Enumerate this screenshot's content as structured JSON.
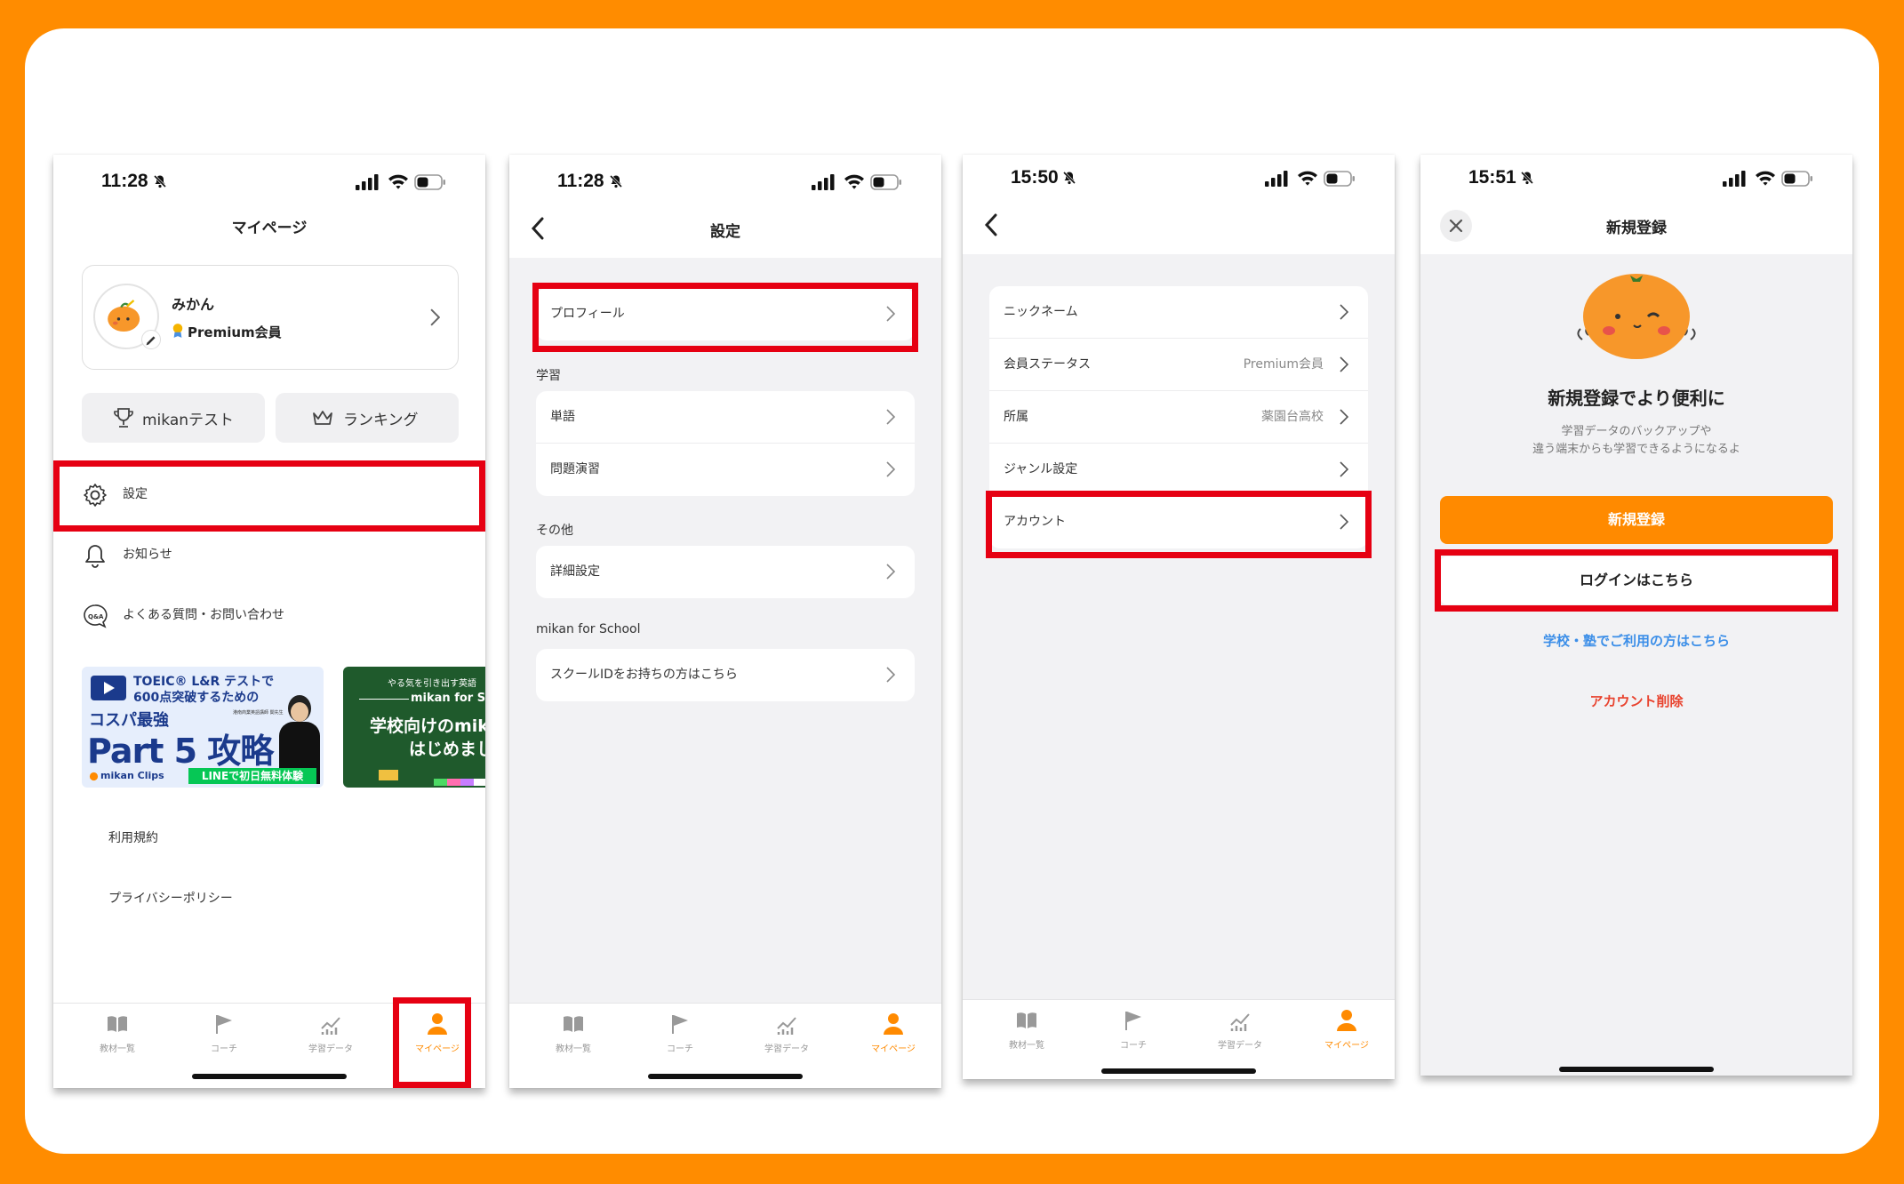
{
  "status_bar": {
    "phone1_time": "11:28",
    "phone2_time": "11:28",
    "phone3_time": "15:50",
    "phone4_time": "15:51"
  },
  "tabs": [
    "教材一覧",
    "コーチ",
    "学習データ",
    "マイページ"
  ],
  "mypage": {
    "title": "マイページ",
    "profile_name": "みかん",
    "profile_status": "Premium会員",
    "test_button": "mikanテスト",
    "ranking_button": "ランキング",
    "menu_settings": "設定",
    "menu_news": "お知らせ",
    "menu_faq": "よくある質問・お問い合わせ",
    "banner1": {
      "line1": "TOEIC® L&R テストで",
      "line2": "600点突破するための",
      "line3": "コスパ最強",
      "big": "Part 5 攻略",
      "caption": "港南商業英語講師 関先生",
      "brand": "mikan Clips",
      "cta": "LINEで初日無料体験"
    },
    "banner2": {
      "line1": "やる気を引き出す英語",
      "line2": "mikan for Sc",
      "line3": "学校向けのmik",
      "line4": "はじめまし"
    },
    "link_terms": "利用規約",
    "link_privacy": "プライバシーポリシー"
  },
  "settings": {
    "title": "設定",
    "profile_row": "プロフィール",
    "section_study": "学習",
    "row_words": "単語",
    "row_drills": "問題演習",
    "section_other": "その他",
    "row_detail": "詳細設定",
    "section_school": "mikan for School",
    "row_school_id": "スクールIDをお持ちの方はこちら"
  },
  "profile": {
    "rows": [
      {
        "label": "ニックネーム",
        "value": ""
      },
      {
        "label": "会員ステータス",
        "value": "Premium会員"
      },
      {
        "label": "所属",
        "value": "薬園台高校"
      },
      {
        "label": "ジャンル設定",
        "value": ""
      },
      {
        "label": "アカウント",
        "value": ""
      }
    ]
  },
  "signup": {
    "title": "新規登録",
    "headline": "新規登録でより便利に",
    "desc1": "学習データのバックアップや",
    "desc2": "違う端末からも学習できるようになるよ",
    "register_button": "新規登録",
    "login_button": "ログインはこちら",
    "school_link": "学校・塾でご利用の方はこちら",
    "delete_link": "アカウント削除"
  },
  "colors": {
    "background": "#ff8c00",
    "accent": "#ff8a00",
    "highlight": "#e60012",
    "link_blue": "#3b8ee8",
    "delete_red": "#e8412c"
  }
}
